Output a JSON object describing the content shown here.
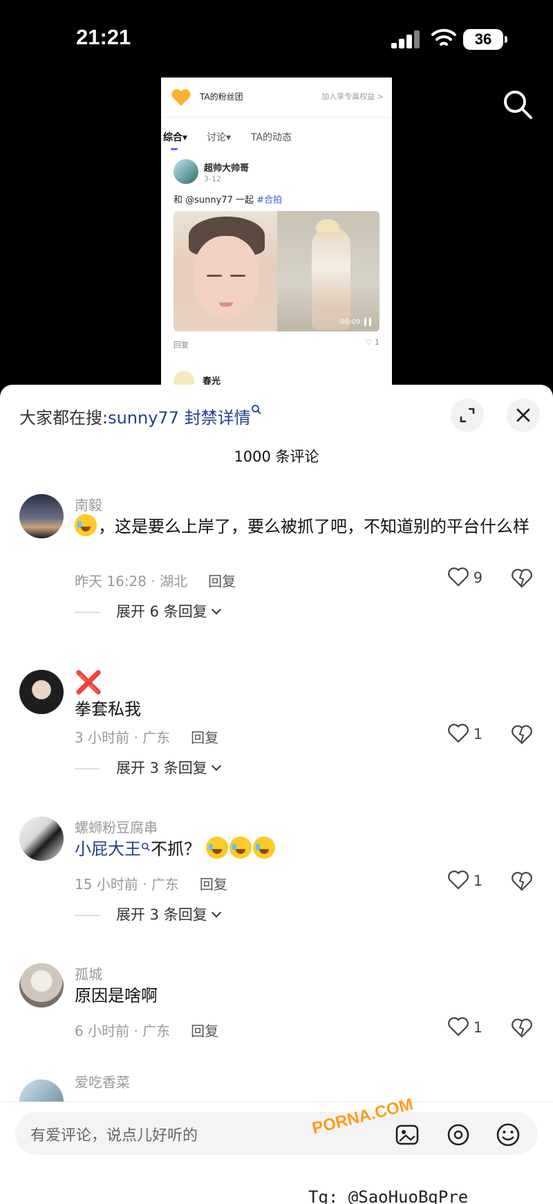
{
  "status_bar": {
    "time": "21:21",
    "battery": "36"
  },
  "preview": {
    "fan_group_title": "TA的粉丝团",
    "fan_group_join": "加入享专属权益 >",
    "tabs": [
      "综合",
      "讨论",
      "TA的动态"
    ],
    "tab_arrows": [
      "▾",
      "▾"
    ],
    "post": {
      "author": "超帅大帅哥",
      "date": "3-12",
      "text_prefix": "和 @sunny77 一起 ",
      "hashtag": "#合拍",
      "video_time": "00:09",
      "reply": "回复",
      "likes": "1",
      "like_icon": "♡"
    },
    "next_author": "春光"
  },
  "sheet": {
    "trending_label": "大家都在搜:",
    "trending_query": "sunny77 封禁详情",
    "search_glyph": "🔍",
    "count_title": "1000 条评论",
    "comments": [
      {
        "name": "南毅",
        "text": "，这是要么上岸了，要么被抓了吧，不知道别的平台什么样",
        "time_loc": "昨天 16:28 · 湖北",
        "reply": "回复",
        "likes": "9",
        "expand": "展开 6 条回复"
      },
      {
        "name": "❌",
        "text": "拳套私我",
        "time_loc": "3 小时前 · 广东",
        "reply": "回复",
        "likes": "1",
        "expand": "展开 3 条回复"
      },
      {
        "name": "螺蛳粉豆腐串",
        "mention": "小屁大王",
        "text": "不抓？",
        "time_loc": "15 小时前 · 广东",
        "reply": "回复",
        "likes": "1",
        "expand": "展开 3 条回复"
      },
      {
        "name": "孤城",
        "text": "原因是啥啊",
        "time_loc": "6 小时前 · 广东",
        "reply": "回复",
        "likes": "1"
      },
      {
        "name": "爱吃香菜"
      }
    ]
  },
  "input": {
    "placeholder": "有爱评论，说点儿好听的"
  },
  "watermarks": {
    "site": "PORNA.COM",
    "tg": "Tg: @SaoHuoBgPre"
  }
}
